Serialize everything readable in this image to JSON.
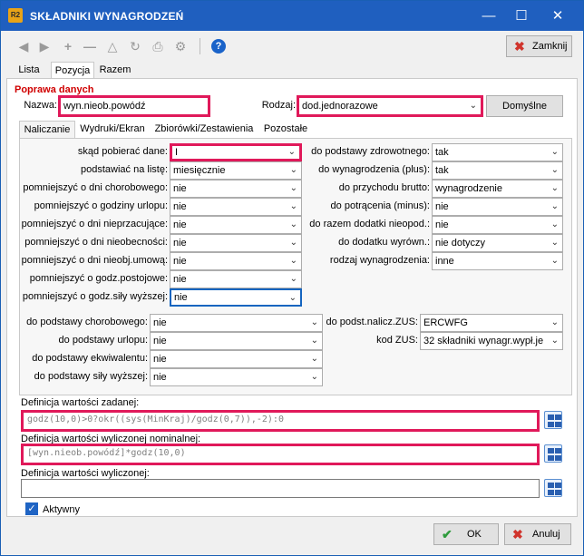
{
  "window": {
    "app_icon": "R2",
    "title": "SKŁADNIKI WYNAGRODZEŃ",
    "minimize": "—",
    "maximize": "☐",
    "close": "✕"
  },
  "toolbar": {
    "close_label": "Zamknij"
  },
  "tabs": [
    "Lista",
    "Pozycja",
    "Razem"
  ],
  "section_title": "Poprawa danych",
  "header": {
    "nazwa_label": "Nazwa:",
    "nazwa_value": "wyn.nieob.powódź",
    "rodzaj_label": "Rodzaj:",
    "rodzaj_value": "dod.jednorazowe",
    "defaults_label": "Domyślne"
  },
  "subtabs": [
    "Naliczanie",
    "Wydruki/Ekran",
    "Zbiorówki/Zestawienia",
    "Pozostałe"
  ],
  "left_fields": [
    {
      "label": "skąd pobierać dane:",
      "value": "I"
    },
    {
      "label": "podstawiać na listę:",
      "value": "miesięcznie"
    },
    {
      "label": "pomniejszyć o dni chorobowego:",
      "value": "nie"
    },
    {
      "label": "pomniejszyć o godziny urlopu:",
      "value": "nie"
    },
    {
      "label": "pomniejszyć o dni nieprzacujące:",
      "value": "nie"
    },
    {
      "label": "pomniejszyć o dni nieobecności:",
      "value": "nie"
    },
    {
      "label": "pomniejszyć o dni nieobj.umową:",
      "value": "nie"
    },
    {
      "label": "pomniejszyć o godz.postojowe:",
      "value": "nie"
    },
    {
      "label": "pomniejszyć o godz.siły wyższej:",
      "value": "nie"
    }
  ],
  "right_fields": [
    {
      "label": "do podstawy zdrowotnego:",
      "value": "tak"
    },
    {
      "label": "do wynagrodzenia (plus):",
      "value": "tak"
    },
    {
      "label": "do przychodu brutto:",
      "value": "wynagrodzenie"
    },
    {
      "label": "do potrącenia (minus):",
      "value": "nie"
    },
    {
      "label": "do razem dodatki nieopod.:",
      "value": "nie"
    },
    {
      "label": "do dodatku wyrówn.:",
      "value": "nie dotyczy"
    },
    {
      "label": "rodzaj wynagrodzenia:",
      "value": "inne"
    }
  ],
  "bottom_left_fields": [
    {
      "label": "do podstawy chorobowego:",
      "value": "nie"
    },
    {
      "label": "do podstawy urlopu:",
      "value": "nie"
    },
    {
      "label": "do podstawy ekwiwalentu:",
      "value": "nie"
    },
    {
      "label": "do podstawy siły wyższej:",
      "value": "nie"
    }
  ],
  "bottom_right_fields": [
    {
      "label": "do podst.nalicz.ZUS:",
      "value": "ERCWFG"
    },
    {
      "label": "kod ZUS:",
      "value": "32 składniki wynagr.wypł.je"
    }
  ],
  "definitions": [
    {
      "label": "Definicja wartości zadanej:",
      "value": "godz(10,0)>0?okr((sys(MinKraj)/godz(0,7)),-2):0"
    },
    {
      "label": "Definicja wartości wyliczonej nominalnej:",
      "value": "[wyn.nieob.powódź]*godz(10,0)"
    },
    {
      "label": "Definicja wartości wyliczonej:",
      "value": ""
    }
  ],
  "aktywny": {
    "label": "Aktywny",
    "checked": true
  },
  "footer": {
    "ok_label": "OK",
    "cancel_label": "Anuluj"
  },
  "colors": {
    "title_bar": "#1f5fbf",
    "highlight": "#e0195a",
    "section_title": "#d00000"
  },
  "icons": [
    "first-record-icon",
    "prev-record-icon",
    "add-icon",
    "delete-icon",
    "filter-icon",
    "refresh-icon",
    "print-icon",
    "settings-icon",
    "help-icon"
  ]
}
